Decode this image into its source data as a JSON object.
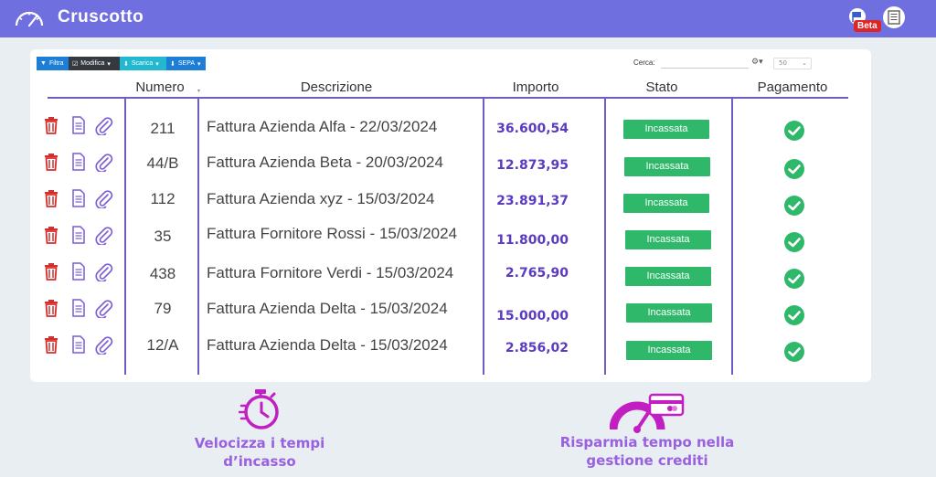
{
  "header": {
    "title": "Cruscotto",
    "beta_label": "Beta"
  },
  "toolbar": {
    "filter_label": "Filtra",
    "edit_label": "Modifica",
    "download_label": "Scarica",
    "sepa_label": "SEPA"
  },
  "search": {
    "label": "Cerca:",
    "value": ""
  },
  "page_size": "50",
  "columns": {
    "numero": "Numero",
    "descrizione": "Descrizione",
    "importo": "Importo",
    "stato": "Stato",
    "pagamento": "Pagamento"
  },
  "rows": [
    {
      "numero": "211",
      "descrizione": "Fattura Azienda Alfa - 22/03/2024",
      "importo": "36.600,54",
      "stato": "Incassata"
    },
    {
      "numero": "44/B",
      "descrizione": "Fattura Azienda Beta - 20/03/2024",
      "importo": "12.873,95",
      "stato": "Incassata"
    },
    {
      "numero": "112",
      "descrizione": "Fattura Azienda xyz - 15/03/2024",
      "importo": "23.891,37",
      "stato": "Incassata"
    },
    {
      "numero": "35",
      "descrizione": "Fattura Fornitore Rossi - 15/03/2024",
      "importo": "11.800,00",
      "stato": "Incassata"
    },
    {
      "numero": "438",
      "descrizione": "Fattura Fornitore Verdi - 15/03/2024",
      "importo": "2.765,90",
      "stato": "Incassata"
    },
    {
      "numero": "79",
      "descrizione": "Fattura Azienda Delta - 15/03/2024",
      "importo": "15.000,00",
      "stato": "Incassata"
    },
    {
      "numero": "12/A",
      "descrizione": "Fattura Azienda Delta - 15/03/2024",
      "importo": "2.856,02",
      "stato": "Incassata"
    }
  ],
  "features": {
    "left_line1": "Velocizza i tempi",
    "left_line2": "d’incasso",
    "right_line1": "Risparmia tempo nella",
    "right_line2": "gestione crediti"
  },
  "colors": {
    "header_bg": "#6f6fe0",
    "accent_purple": "#6b5fc7",
    "delete_red": "#d32f2f",
    "status_green": "#2fb86a",
    "feature_magenta": "#c21fc2"
  },
  "icons": [
    "speedometer-icon",
    "flag-icon",
    "document-icon",
    "trash-icon",
    "file-icon",
    "paperclip-icon",
    "check-circle-icon",
    "stopwatch-icon",
    "gauge-card-icon"
  ]
}
